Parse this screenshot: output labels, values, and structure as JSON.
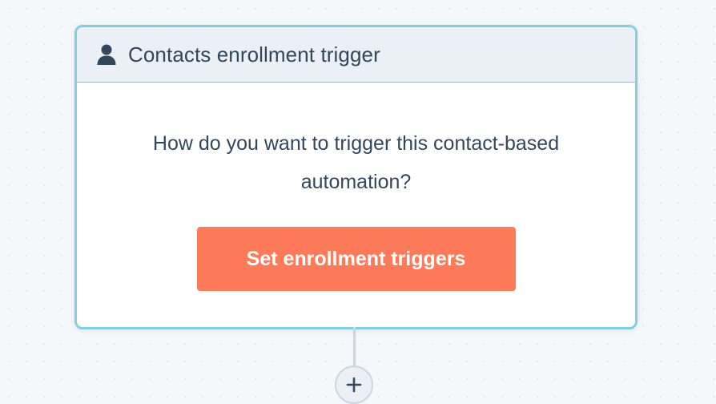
{
  "trigger_card": {
    "header": {
      "icon": "person-icon",
      "title": "Contacts enrollment trigger"
    },
    "question": "How do you want to trigger this contact-based automation?",
    "button_label": "Set enrollment triggers"
  },
  "add_step": {
    "icon": "plus-icon"
  },
  "colors": {
    "card_border": "#7fd1de",
    "header_background": "#eaf0f6",
    "text": "#33475b",
    "button_background": "#ff7a59",
    "connector": "#cbd6e2"
  }
}
